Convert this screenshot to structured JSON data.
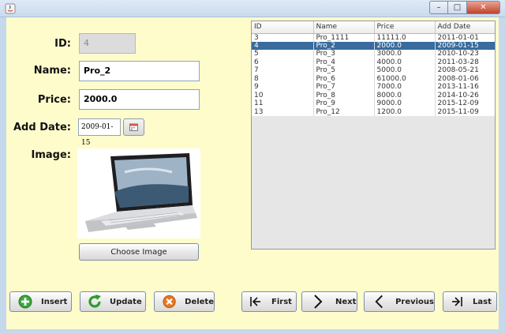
{
  "window": {
    "minimize_glyph": "–",
    "maximize_glyph": "□",
    "close_glyph": "✕"
  },
  "form": {
    "id_label": "ID:",
    "id_value": "4",
    "name_label": "Name:",
    "name_value": "Pro_2",
    "price_label": "Price:",
    "price_value": "2000.0",
    "date_label": "Add Date:",
    "date_value": "2009-01-15",
    "image_label": "Image:",
    "choose_image_label": "Choose Image"
  },
  "table": {
    "headers": [
      "ID",
      "Name",
      "Price",
      "Add Date"
    ],
    "rows": [
      [
        "3",
        "Pro_1111",
        "11111.0",
        "2011-01-01"
      ],
      [
        "4",
        "Pro_2",
        "2000.0",
        "2009-01-15"
      ],
      [
        "5",
        "Pro_3",
        "3000.0",
        "2010-10-23"
      ],
      [
        "6",
        "Pro_4",
        "4000.0",
        "2011-03-28"
      ],
      [
        "7",
        "Pro_5",
        "5000.0",
        "2008-05-21"
      ],
      [
        "8",
        "Pro_6",
        "61000.0",
        "2008-01-06"
      ],
      [
        "9",
        "Pro_7",
        "7000.0",
        "2013-11-16"
      ],
      [
        "10",
        "Pro_8",
        "8000.0",
        "2014-10-26"
      ],
      [
        "11",
        "Pro_9",
        "9000.0",
        "2015-12-09"
      ],
      [
        "13",
        "Pro_12",
        "1200.0",
        "2015-11-09"
      ]
    ],
    "selected_row": 1
  },
  "actions": {
    "insert": "Insert",
    "update": "Update",
    "delete": "Delete",
    "first": "First",
    "next": "Next",
    "previous": "Previous",
    "last": "Last"
  },
  "colors": {
    "background": "#fffccc",
    "selection": "#396b9c",
    "insert_icon": "#3aa83a",
    "update_icon": "#2f9a2f",
    "delete_icon": "#e87722"
  }
}
